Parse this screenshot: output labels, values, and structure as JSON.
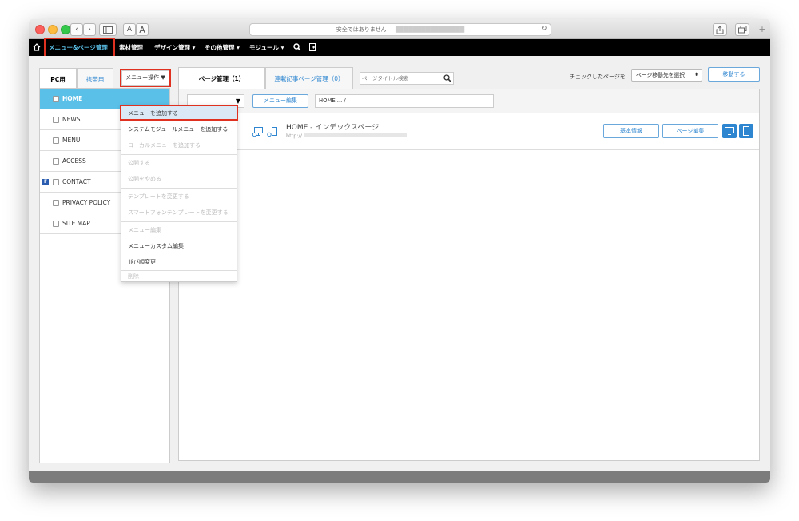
{
  "browser": {
    "address_text": "安全ではありません — ",
    "address_masked": "████████████████",
    "font_small": "A",
    "font_large": "A"
  },
  "navbar": {
    "items": [
      {
        "label": "メニュー&ページ管理",
        "active": true
      },
      {
        "label": "素材管理"
      },
      {
        "label": "デザイン管理 ▾"
      },
      {
        "label": "その他管理 ▾"
      },
      {
        "label": "モジュール ▾"
      }
    ]
  },
  "tabs": {
    "pc": "PC用",
    "mobile": "携帯用",
    "menu_ops": "メニュー操作 ▼",
    "page_manage": "ページ管理（1）",
    "serial_pages": "連載記事ページ管理（0）"
  },
  "search": {
    "placeholder": "ページタイトル検索"
  },
  "bulk": {
    "label": "チェックしたページを",
    "select_value": "ページ移動先を選択",
    "move_button": "移動する"
  },
  "sidebar": {
    "items": [
      {
        "label": "HOME",
        "selected": true
      },
      {
        "label": "NEWS"
      },
      {
        "label": "MENU"
      },
      {
        "label": "ACCESS"
      },
      {
        "label": "CONTACT",
        "badge": "F"
      },
      {
        "label": "PRIVACY POLICY"
      },
      {
        "label": "SITE MAP"
      }
    ]
  },
  "main": {
    "menu_edit_button": "メニュー編集",
    "breadcrumb": "HOME ... /",
    "page_title": "HOME",
    "page_subtitle": " - インデックスページ",
    "page_url": "http://",
    "basic_info_button": "基本情報",
    "page_edit_button": "ページ編集"
  },
  "dropdown": {
    "items": [
      {
        "label": "メニューを追加する",
        "highlighted": true
      },
      {
        "label": "システムモジュールメニューを追加する"
      },
      {
        "label": "ローカルメニューを追加する",
        "disabled": true
      },
      {
        "label": "公開する",
        "disabled": true
      },
      {
        "label": "公開をやめる",
        "disabled": true
      },
      {
        "label": "テンプレートを変更する",
        "disabled": true
      },
      {
        "label": "スマートフォンテンプレートを変更する",
        "disabled": true
      },
      {
        "label": "メニュー編集",
        "disabled": true
      },
      {
        "label": "メニューカスタム編集"
      },
      {
        "label": "並び順変更"
      },
      {
        "label": "削除",
        "disabled": true
      }
    ]
  },
  "colors": {
    "accent": "#2e86d1",
    "sidebar_selected": "#5bc0e8",
    "highlight_border": "#e03020"
  }
}
